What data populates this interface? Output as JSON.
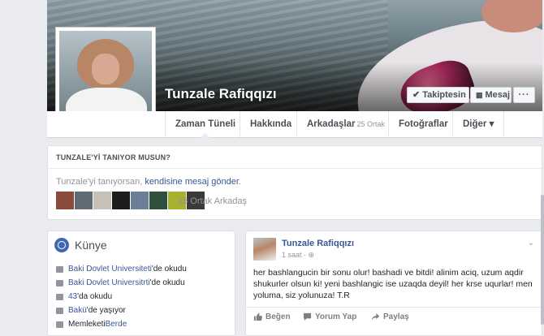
{
  "profile": {
    "name": "Tunzale Rafiqqızı",
    "follow_label": "Takiptesin",
    "message_label": "Mesaj",
    "more_label": "···"
  },
  "nav": {
    "timeline": "Zaman Tüneli",
    "about": "Hakkında",
    "friends": "Arkadaşlar",
    "friends_count": "25 Ortak",
    "photos": "Fotoğraflar",
    "more": "Diğer ▾"
  },
  "know": {
    "title": "TUNZALE'Yİ TANIYOR MUSUN?",
    "text_prefix": "Tunzale'yi tanıyorsan, ",
    "link": "kendisine mesaj gönder",
    "text_suffix": ".",
    "mutual_count": "25 Ortak Arkadaş",
    "mutual_colors": [
      "#8b4b3b",
      "#5f6b75",
      "#c7c0b6",
      "#1d1d1d",
      "#6b7f96",
      "#2f4f3f",
      "#a8b030",
      "#3a3a3a"
    ]
  },
  "intro": {
    "title": "Künye",
    "items": [
      {
        "link": "Baki Dovlet Universiteti",
        "suffix": "'de okudu"
      },
      {
        "link": "Baki Dovlet Universitrti",
        "suffix": "'de okudu"
      },
      {
        "link": "43",
        "suffix": "'da okudu"
      },
      {
        "link": "Bakü",
        "suffix": "'de yaşıyor"
      },
      {
        "prefix": "Memleketi ",
        "link": "Berde"
      }
    ]
  },
  "post": {
    "author": "Tunzale Rafiqqızı",
    "time": "1 saat · ",
    "text": "her bashlangucin bir sonu olur! bashadi ve bitdi! alinim aciq, uzum aqdir shukurler olsun ki! yeni bashlangic ise uzaqda deyil! her krse uqurlar! men yoluma, siz yolunuza! T.R",
    "like": "Beğen",
    "comment": "Yorum Yap",
    "share": "Paylaş"
  }
}
